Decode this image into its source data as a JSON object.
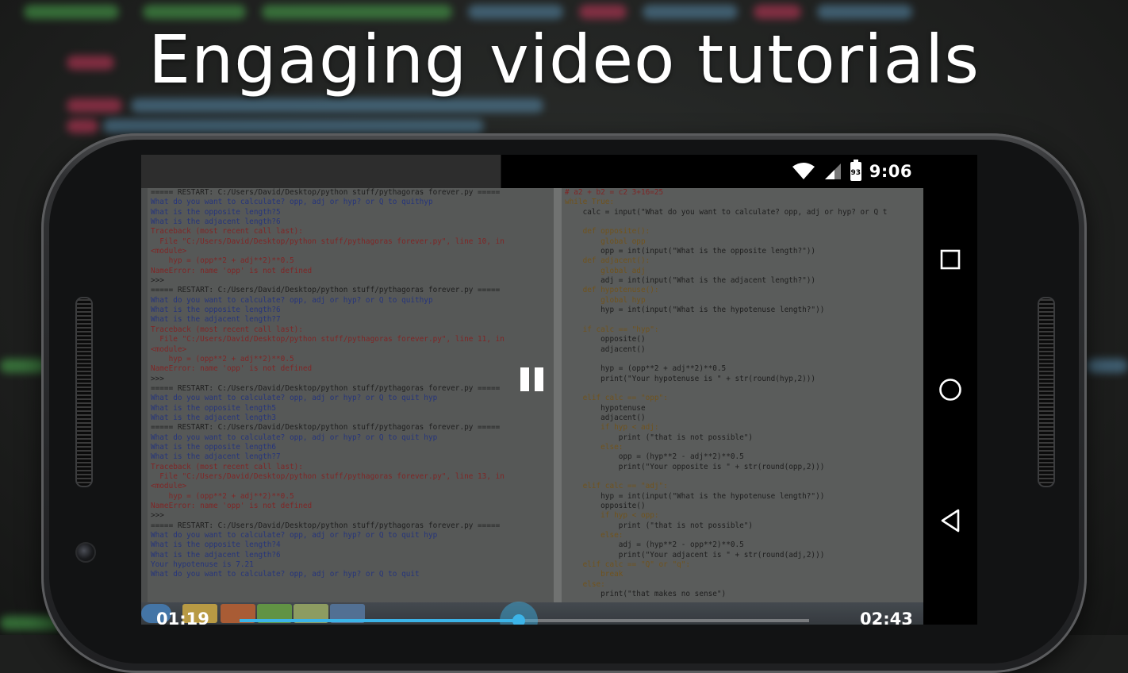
{
  "headline": "Engaging video tutorials",
  "status_bar": {
    "battery_level": "93",
    "time": "9:06",
    "icons": [
      "wifi-icon",
      "cell-signal-icon",
      "battery-icon"
    ]
  },
  "nav_bar": {
    "buttons": [
      "recents-square-icon",
      "home-circle-icon",
      "back-triangle-icon"
    ]
  },
  "player": {
    "elapsed": "01:19",
    "duration": "02:43",
    "progress": 0.49,
    "state": "playing",
    "accent_color": "#3cb4e8"
  },
  "video_frame": {
    "shell_lines": [
      "===== RESTART: C:/Users/David/Desktop/python stuff/pythagoras forever.py =====",
      "What do you want to calculate? opp, adj or hyp? or Q to quithyp",
      "What is the opposite length?5",
      "What is the adjacent length?6",
      "Traceback (most recent call last):",
      "  File \"C:/Users/David/Desktop/python stuff/pythagoras forever.py\", line 10, in",
      "<module>",
      "    hyp = (opp**2 + adj**2)**0.5",
      "NameError: name 'opp' is not defined",
      ">>>",
      "===== RESTART: C:/Users/David/Desktop/python stuff/pythagoras forever.py =====",
      "What do you want to calculate? opp, adj or hyp? or Q to quithyp",
      "What is the opposite length?6",
      "What is the adjacent length?7",
      "Traceback (most recent call last):",
      "  File \"C:/Users/David/Desktop/python stuff/pythagoras forever.py\", line 11, in",
      "<module>",
      "    hyp = (opp**2 + adj**2)**0.5",
      "NameError: name 'opp' is not defined",
      ">>>",
      "===== RESTART: C:/Users/David/Desktop/python stuff/pythagoras forever.py =====",
      "What do you want to calculate? opp, adj or hyp? or Q to quit hyp",
      "What is the opposite length5",
      "What is the adjacent length3",
      "===== RESTART: C:/Users/David/Desktop/python stuff/pythagoras forever.py =====",
      "What do you want to calculate? opp, adj or hyp? or Q to quit hyp",
      "What is the opposite length6",
      "What is the adjacent length?7",
      "Traceback (most recent call last):",
      "  File \"C:/Users/David/Desktop/python stuff/pythagoras forever.py\", line 13, in",
      "<module>",
      "    hyp = (opp**2 + adj**2)**0.5",
      "NameError: name 'opp' is not defined",
      ">>>",
      "===== RESTART: C:/Users/David/Desktop/python stuff/pythagoras forever.py =====",
      "What do you want to calculate? opp, adj or hyp? or Q to quit hyp",
      "What is the opposite length?4",
      "What is the adjacent length?6",
      "Your hypotenuse is 7.21",
      "What do you want to calculate? opp, adj or hyp? or Q to quit"
    ],
    "editor_lines": [
      "# a2 + b2 = c2 3+16=25",
      "while True:",
      "    calc = input(\"What do you want to calculate? opp, adj or hyp? or Q t",
      "",
      "    def opposite():",
      "        global opp",
      "        opp = int(input(\"What is the opposite length?\"))",
      "    def adjacent():",
      "        global adj",
      "        adj = int(input(\"What is the adjacent length?\"))",
      "    def hypotenuse():",
      "        global hyp",
      "        hyp = int(input(\"What is the hypotenuse length?\"))",
      "",
      "    if calc == \"hyp\":",
      "        opposite()",
      "        adjacent()",
      "",
      "        hyp = (opp**2 + adj**2)**0.5",
      "        print(\"Your hypotenuse is \" + str(round(hyp,2)))",
      "",
      "    elif calc == \"opp\":",
      "        hypotenuse",
      "        adjacent()",
      "        if hyp < adj:",
      "            print (\"that is not possible\")",
      "        else:",
      "            opp = (hyp**2 - adj**2)**0.5",
      "            print(\"Your opposite is \" + str(round(opp,2)))",
      "",
      "    elif calc == \"adj\":",
      "        hyp = int(input(\"What is the hypotenuse length?\"))",
      "        opposite()",
      "        if hyp < opp:",
      "            print (\"that is not possible\")",
      "        else:",
      "            adj = (hyp**2 - opp**2)**0.5",
      "            print(\"Your adjacent is \" + str(round(adj,2)))",
      "    elif calc == \"Q\" or \"q\":",
      "        break",
      "    else:",
      "        print(\"that makes no sense\")"
    ]
  }
}
